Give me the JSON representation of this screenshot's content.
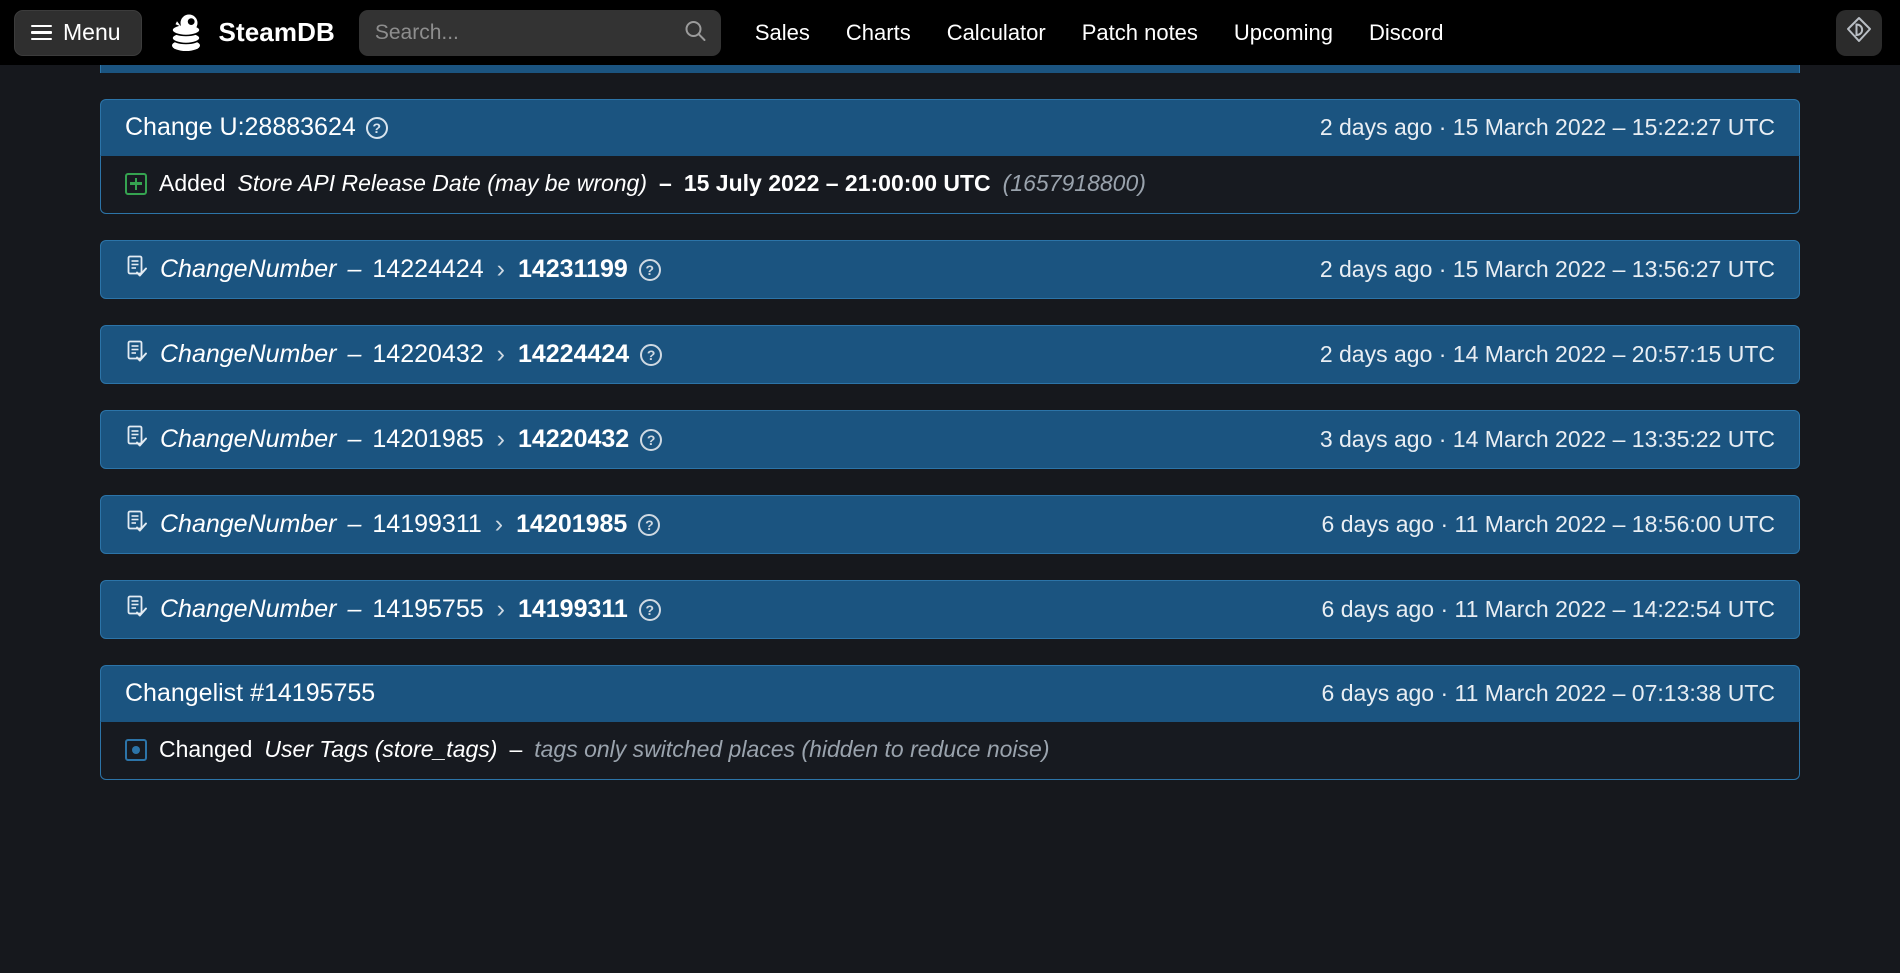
{
  "header": {
    "menu_label": "Menu",
    "brand": "SteamDB",
    "search": {
      "placeholder": "Search...",
      "value": ""
    },
    "nav": [
      {
        "label": "Sales"
      },
      {
        "label": "Charts"
      },
      {
        "label": "Calculator"
      },
      {
        "label": "Patch notes"
      },
      {
        "label": "Upcoming"
      },
      {
        "label": "Discord"
      }
    ],
    "login_icon": "steam-login-icon"
  },
  "colors": {
    "page_bg": "#16181d",
    "header_bg": "#000000",
    "row_blue": "#1b5480",
    "row_border": "#2c74a8",
    "body_bg": "#171a20",
    "add_green": "#35a350",
    "mod_blue": "#2c74a8"
  },
  "changes": [
    {
      "kind": "card",
      "title": "Change U:28883624",
      "help": "?",
      "time": "2 days ago · 15 March 2022 – 15:22:27 UTC",
      "lines": [
        {
          "icon": "add-icon",
          "action": "Added",
          "field": "Store API Release Date (may be wrong)",
          "dash": "–",
          "value": "15 July 2022 – 21:00:00 UTC",
          "note": "(1657918800)"
        }
      ]
    },
    {
      "kind": "row",
      "icon": "changenumber-icon",
      "label": "ChangeNumber",
      "dash": "–",
      "old": "14224424",
      "chev": "›",
      "new": "14231199",
      "help": "?",
      "time": "2 days ago · 15 March 2022 – 13:56:27 UTC"
    },
    {
      "kind": "row",
      "icon": "changenumber-icon",
      "label": "ChangeNumber",
      "dash": "–",
      "old": "14220432",
      "chev": "›",
      "new": "14224424",
      "help": "?",
      "time": "2 days ago · 14 March 2022 – 20:57:15 UTC"
    },
    {
      "kind": "row",
      "icon": "changenumber-icon",
      "label": "ChangeNumber",
      "dash": "–",
      "old": "14201985",
      "chev": "›",
      "new": "14220432",
      "help": "?",
      "time": "3 days ago · 14 March 2022 – 13:35:22 UTC"
    },
    {
      "kind": "row",
      "icon": "changenumber-icon",
      "label": "ChangeNumber",
      "dash": "–",
      "old": "14199311",
      "chev": "›",
      "new": "14201985",
      "help": "?",
      "time": "6 days ago · 11 March 2022 – 18:56:00 UTC"
    },
    {
      "kind": "row",
      "icon": "changenumber-icon",
      "label": "ChangeNumber",
      "dash": "–",
      "old": "14195755",
      "chev": "›",
      "new": "14199311",
      "help": "?",
      "time": "6 days ago · 11 March 2022 – 14:22:54 UTC"
    },
    {
      "kind": "card",
      "title": "Changelist #14195755",
      "help": "",
      "time": "6 days ago · 11 March 2022 – 07:13:38 UTC",
      "lines": [
        {
          "icon": "modified-icon",
          "action": "Changed",
          "field": "User Tags (store_tags)",
          "dash": "–",
          "value": "",
          "note": "tags only switched places (hidden to reduce noise)"
        }
      ]
    }
  ]
}
